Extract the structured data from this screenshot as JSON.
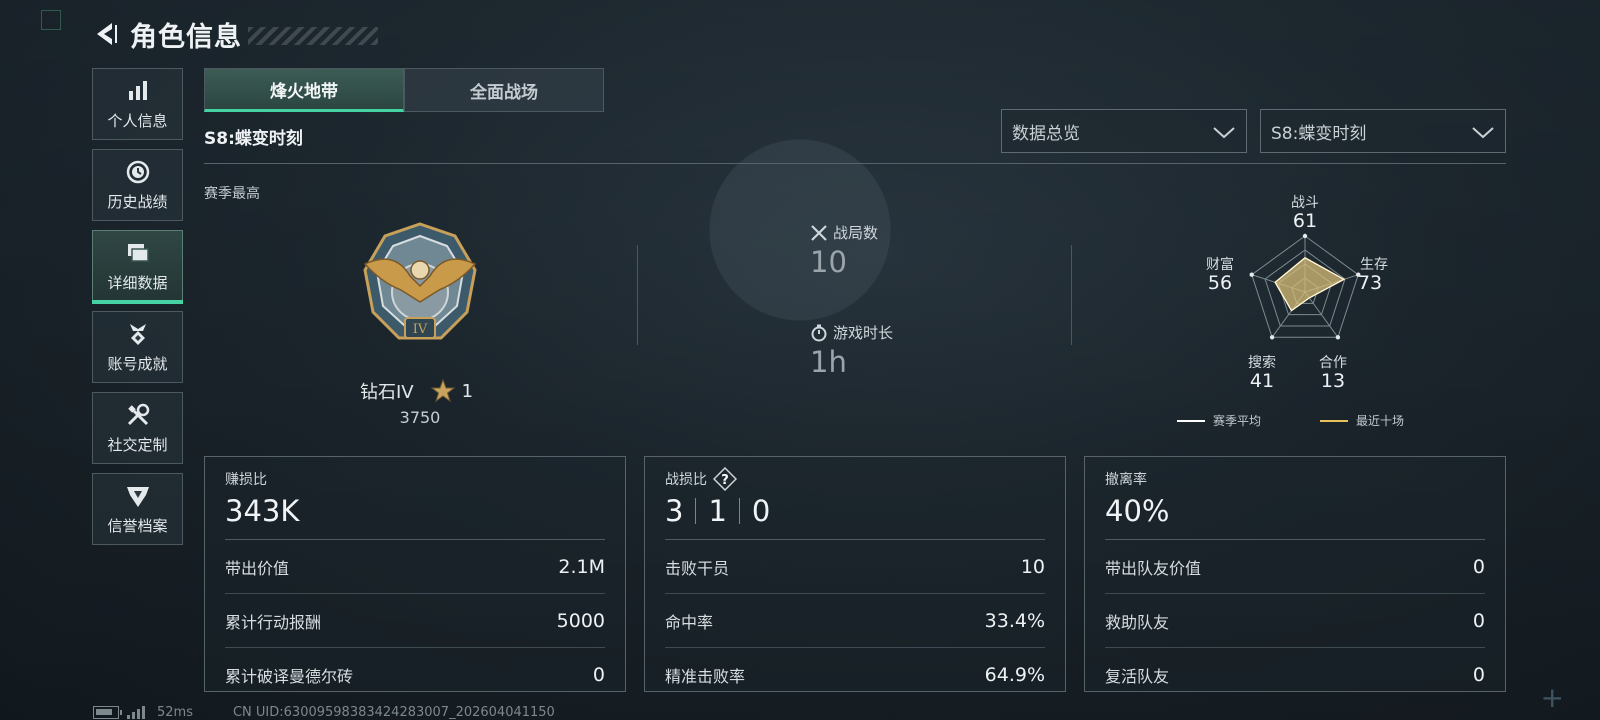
{
  "header": {
    "title": "角色信息"
  },
  "sidebar": {
    "items": [
      {
        "label": "个人信息",
        "icon": "bar-chart-icon"
      },
      {
        "label": "历史战绩",
        "icon": "history-clock-icon"
      },
      {
        "label": "详细数据",
        "icon": "cards-icon",
        "active": true
      },
      {
        "label": "账号成就",
        "icon": "achievement-icon"
      },
      {
        "label": "社交定制",
        "icon": "tools-icon"
      },
      {
        "label": "信誉档案",
        "icon": "credit-shield-icon"
      }
    ]
  },
  "tabs": [
    {
      "label": "烽火地带",
      "active": true
    },
    {
      "label": "全面战场",
      "active": false
    }
  ],
  "season_title": "S8:蝶变时刻",
  "filters": {
    "view": "数据总览",
    "season": "S8:蝶变时刻"
  },
  "season_best": {
    "label": "赛季最高",
    "rank_name": "钻石IV",
    "stars": "1",
    "score": "3750"
  },
  "match_stats": {
    "matches_label": "战局数",
    "matches_value": "10",
    "playtime_label": "游戏时长",
    "playtime_value": "1h"
  },
  "radar": {
    "axes": [
      {
        "label": "战斗",
        "value": "61"
      },
      {
        "label": "生存",
        "value": "73"
      },
      {
        "label": "合作",
        "value": "13"
      },
      {
        "label": "搜索",
        "value": "41"
      },
      {
        "label": "财富",
        "value": "56"
      }
    ],
    "scores": [
      61,
      73,
      13,
      41,
      56
    ],
    "legend_season_avg": "赛季平均",
    "legend_recent": "最近十场",
    "color_season_avg": "#ffffff",
    "color_recent": "#e8c15a"
  },
  "cards": {
    "profit": {
      "title": "赚损比",
      "value": "343K",
      "rows": [
        {
          "label": "带出价值",
          "value": "2.1M"
        },
        {
          "label": "累计行动报酬",
          "value": "5000"
        },
        {
          "label": "累计破译曼德尔砖",
          "value": "0"
        }
      ]
    },
    "kd": {
      "title": "战损比",
      "kills": "3",
      "deaths": "1",
      "assists": "0",
      "rows": [
        {
          "label": "击败干员",
          "value": "10"
        },
        {
          "label": "命中率",
          "value": "33.4%"
        },
        {
          "label": "精准击败率",
          "value": "64.9%"
        }
      ]
    },
    "extract": {
      "title": "撤离率",
      "value": "40%",
      "rows": [
        {
          "label": "带出队友价值",
          "value": "0"
        },
        {
          "label": "救助队友",
          "value": "0"
        },
        {
          "label": "复活队友",
          "value": "0"
        }
      ]
    }
  },
  "footer": {
    "ping": "52ms",
    "uid": "CN UID:6300959838342428300​7_202604041150"
  },
  "colors": {
    "accent": "#46d3a4"
  }
}
